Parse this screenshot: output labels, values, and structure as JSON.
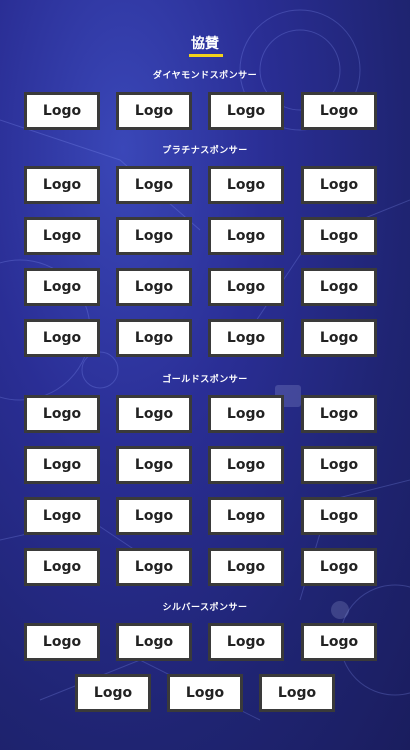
{
  "title": "協賛",
  "tiers": {
    "diamond": {
      "label": "ダイヤモンドスポンサー",
      "logos": [
        "Logo",
        "Logo",
        "Logo",
        "Logo"
      ]
    },
    "platinum": {
      "label": "プラチナスポンサー",
      "logos": [
        "Logo",
        "Logo",
        "Logo",
        "Logo",
        "Logo",
        "Logo",
        "Logo",
        "Logo",
        "Logo",
        "Logo",
        "Logo",
        "Logo",
        "Logo",
        "Logo",
        "Logo",
        "Logo"
      ]
    },
    "gold": {
      "label": "ゴールドスポンサー",
      "logos": [
        "Logo",
        "Logo",
        "Logo",
        "Logo",
        "Logo",
        "Logo",
        "Logo",
        "Logo",
        "Logo",
        "Logo",
        "Logo",
        "Logo",
        "Logo",
        "Logo",
        "Logo",
        "Logo"
      ]
    },
    "silver": {
      "label": "シルバースポンサー",
      "logos": [
        "Logo",
        "Logo",
        "Logo",
        "Logo",
        "Logo",
        "Logo",
        "Logo"
      ]
    }
  },
  "colors": {
    "accent": "#f2d21b",
    "background": "#2a2e95",
    "logo_border": "#3a3a3a"
  }
}
